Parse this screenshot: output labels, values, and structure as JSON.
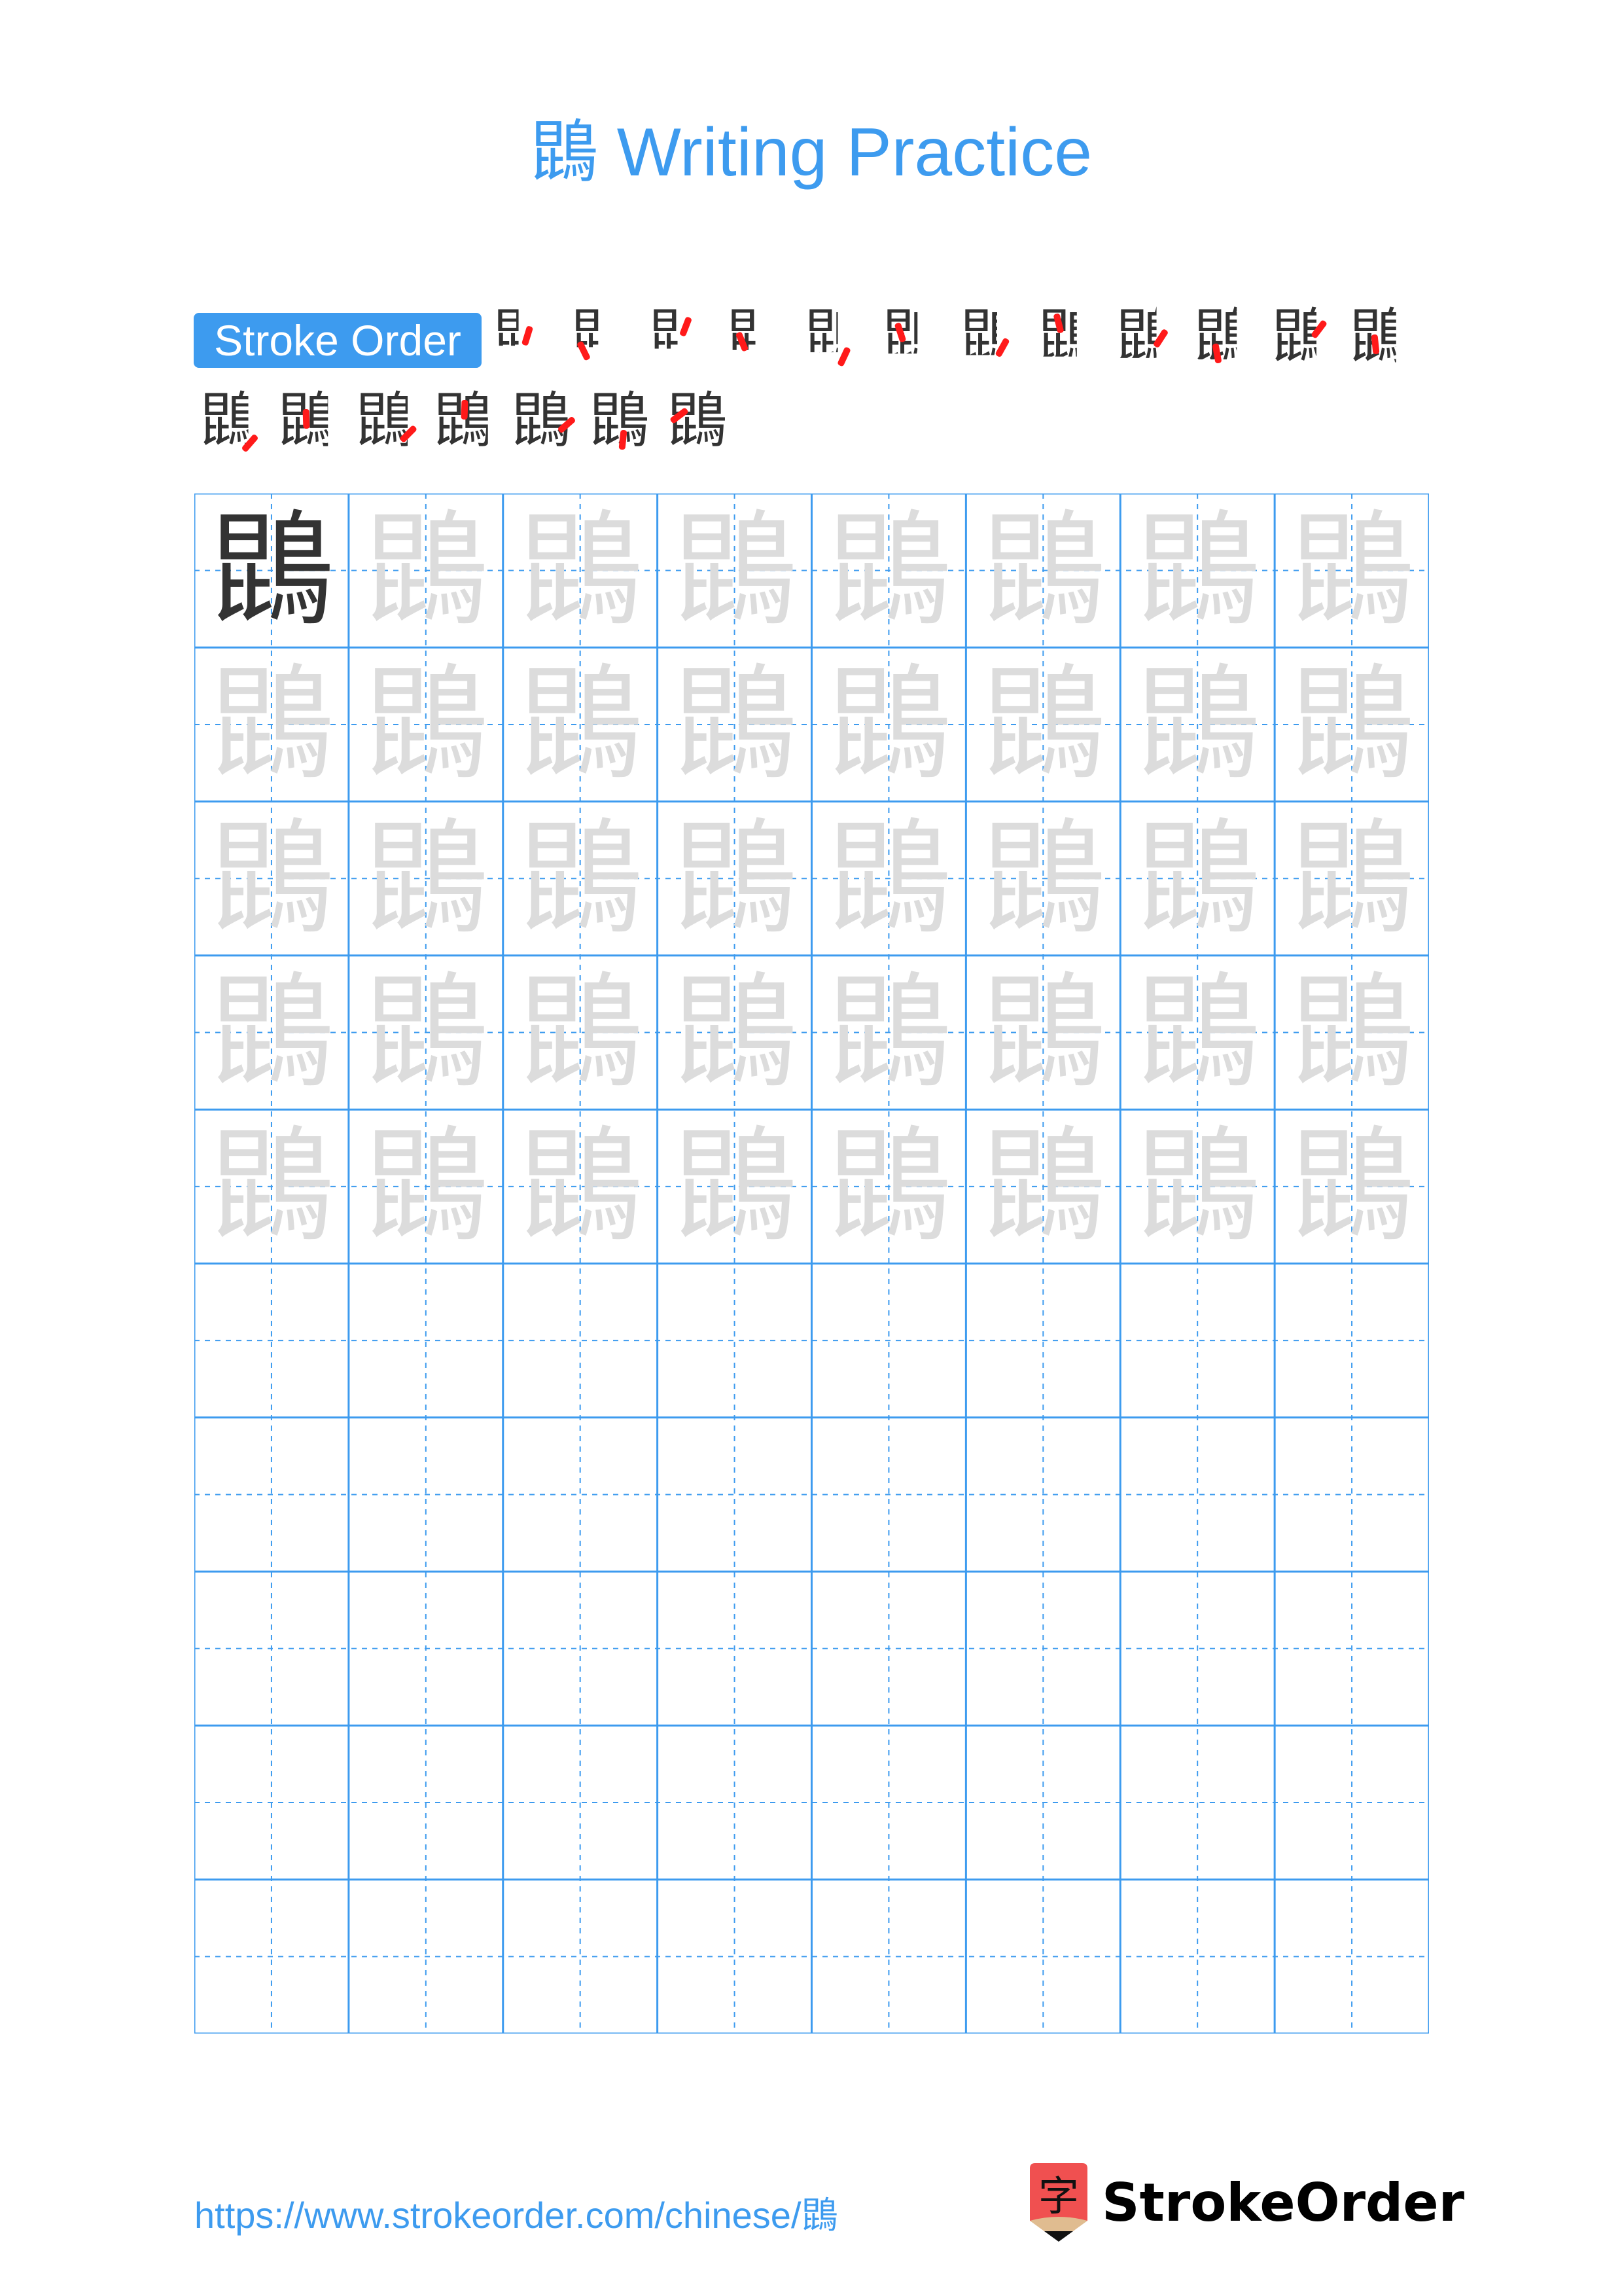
{
  "page": {
    "title": "鵾 Writing Practice",
    "character": "鵾",
    "stroke_order_label": "Stroke Order",
    "stroke_count": 19,
    "steps_row1": [
      1,
      2,
      3,
      4,
      5,
      6,
      7,
      8,
      9,
      10,
      11,
      12
    ],
    "steps_row2": [
      13,
      14,
      15,
      16,
      17,
      18,
      19
    ]
  },
  "grid": {
    "columns": 8,
    "rows": 10,
    "model_cells": 1,
    "trace_rows": 5,
    "empty_rows": 5
  },
  "colors": {
    "accent": "#3d9bef",
    "model_char": "#333333",
    "trace_char": "#dcdcdc",
    "stroke_highlight": "#ff1a1a",
    "logo_red": "#f05050",
    "logo_tan": "#e0bc90"
  },
  "footer": {
    "url": "https://www.strokeorder.com/chinese/鵾",
    "logo_glyph": "字",
    "logo_text": "StrokeOrder"
  }
}
